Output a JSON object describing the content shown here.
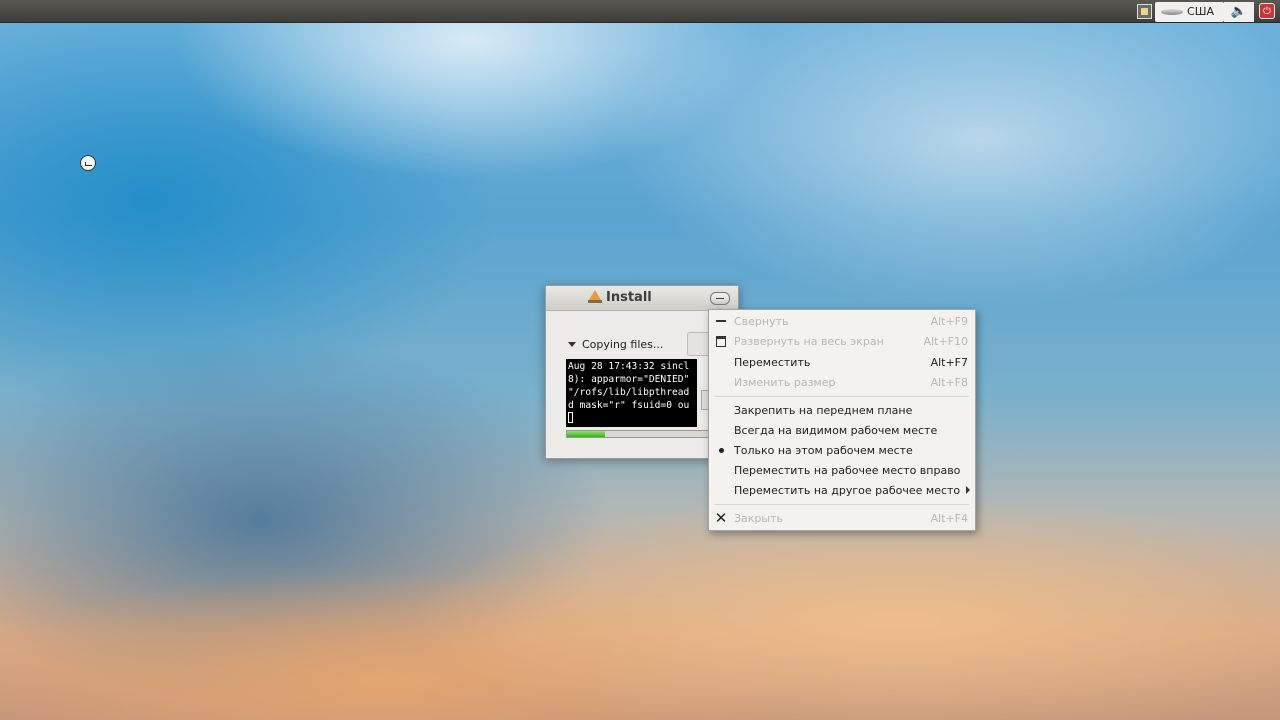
{
  "top_panel": {
    "tray": {
      "network_icon": "network-icon",
      "keyboard_layout": "США",
      "sound_icon": "speaker-icon",
      "power_icon": "power-icon"
    }
  },
  "install_window": {
    "title": "Install",
    "details_label": "Copying files...",
    "terminal_lines": [
      "Aug 28 17:43:32 sincl",
      "8): apparmor=\"DENIED\"",
      "\"/rofs/lib/libpthread",
      "d mask=\"r\" fsuid=0 ou"
    ],
    "progress_fraction": 0.27
  },
  "context_menu": {
    "items": [
      {
        "label": "Свернуть",
        "accel": "Alt+F9",
        "disabled": true,
        "icon": "minimize-icon"
      },
      {
        "label": "Развернуть на весь экран",
        "accel": "Alt+F10",
        "disabled": true,
        "icon": "maximize-icon"
      },
      {
        "label": "Переместить",
        "accel": "Alt+F7",
        "disabled": false,
        "icon": ""
      },
      {
        "label": "Изменить размер",
        "accel": "Alt+F8",
        "disabled": true,
        "icon": ""
      },
      {
        "label": "Закрепить на переднем плане",
        "accel": "",
        "disabled": false,
        "icon": ""
      },
      {
        "label": "Всегда на видимом рабочем месте",
        "accel": "",
        "disabled": false,
        "icon": ""
      },
      {
        "label": "Только на этом рабочем месте",
        "accel": "",
        "disabled": false,
        "icon": "bullet-icon"
      },
      {
        "label": "Переместить на рабочее место вправо",
        "accel": "",
        "disabled": false,
        "icon": ""
      },
      {
        "label": "Переместить на другое рабочее место",
        "accel": "",
        "disabled": false,
        "icon": "submenu-arrow-icon"
      },
      {
        "label": "Закрыть",
        "accel": "Alt+F4",
        "disabled": true,
        "icon": "close-icon"
      }
    ]
  }
}
